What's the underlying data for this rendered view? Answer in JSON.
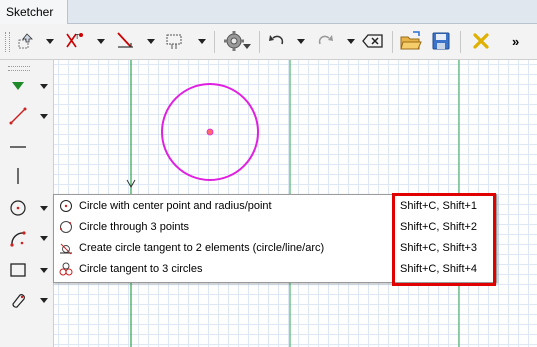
{
  "tab": {
    "title": "Sketcher"
  },
  "toolbar": {
    "buttons": [
      {
        "name": "select-geometry-icon"
      },
      {
        "name": "constraint-icon"
      },
      {
        "name": "trim-icon"
      },
      {
        "name": "view-sketch-icon"
      },
      {
        "name": "settings-gear-icon"
      },
      {
        "name": "undo-icon"
      },
      {
        "name": "redo-icon"
      },
      {
        "name": "delete-icon"
      },
      {
        "name": "open-folder-icon"
      },
      {
        "name": "save-icon"
      },
      {
        "name": "close-sketch-icon"
      }
    ],
    "overflow_label": "»"
  },
  "left_toolbar": {
    "items": [
      {
        "name": "point-icon"
      },
      {
        "name": "line-icon"
      },
      {
        "name": "horizontal-line-icon"
      },
      {
        "name": "vertical-line-icon"
      },
      {
        "name": "circle-icon"
      },
      {
        "name": "arc-icon"
      },
      {
        "name": "rectangle-icon"
      },
      {
        "name": "slot-icon"
      }
    ]
  },
  "menu": {
    "items": [
      {
        "label": "Circle with center point and radius/point",
        "shortcut": "Shift+C, Shift+1",
        "icon": "circle-center-icon"
      },
      {
        "label": "Circle through 3 points",
        "shortcut": "Shift+C, Shift+2",
        "icon": "circle-3points-icon"
      },
      {
        "label": "Create circle tangent to 2 elements (circle/line/arc)",
        "shortcut": "Shift+C, Shift+3",
        "icon": "circle-tangent-2-icon"
      },
      {
        "label": "Circle tangent to 3 circles",
        "shortcut": "Shift+C, Shift+4",
        "icon": "circle-tangent-3-icon"
      }
    ]
  },
  "colors": {
    "sketch_circle": "#e020e0",
    "axis_vertical": "#2aa84a",
    "grid_line": "#dde7f5",
    "highlight_box": "#e00000",
    "center_point": "#ff6a6a"
  }
}
